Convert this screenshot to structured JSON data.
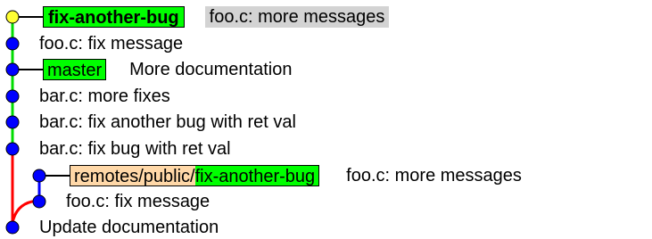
{
  "colors": {
    "commit_fill": "#0000ff",
    "head_fill": "#ffff33",
    "main_line": "#00dd00",
    "merge_line": "#ff0000",
    "branch_tag_bg": "#00ff00",
    "remote_tag_bg": "#ffd8a8",
    "highlight_msg_bg": "#d3d3d3"
  },
  "commits": [
    {
      "refs": [
        {
          "kind": "current",
          "label": "fix-another-bug"
        }
      ],
      "message": "foo.c: more messages",
      "head": true
    },
    {
      "refs": [],
      "message": "foo.c: fix message"
    },
    {
      "refs": [
        {
          "kind": "branch",
          "label": "master"
        }
      ],
      "message": "More documentation"
    },
    {
      "refs": [],
      "message": "bar.c: more fixes"
    },
    {
      "refs": [],
      "message": "bar.c: fix another bug with ret val"
    },
    {
      "refs": [],
      "message": "bar.c: fix bug with ret val"
    },
    {
      "refs": [
        {
          "kind": "remote",
          "prefix": "remotes/public/",
          "label": "fix-another-bug"
        }
      ],
      "message": "foo.c: more messages"
    },
    {
      "refs": [],
      "message": "foo.c: fix message"
    },
    {
      "refs": [],
      "message": "Update documentation"
    }
  ]
}
